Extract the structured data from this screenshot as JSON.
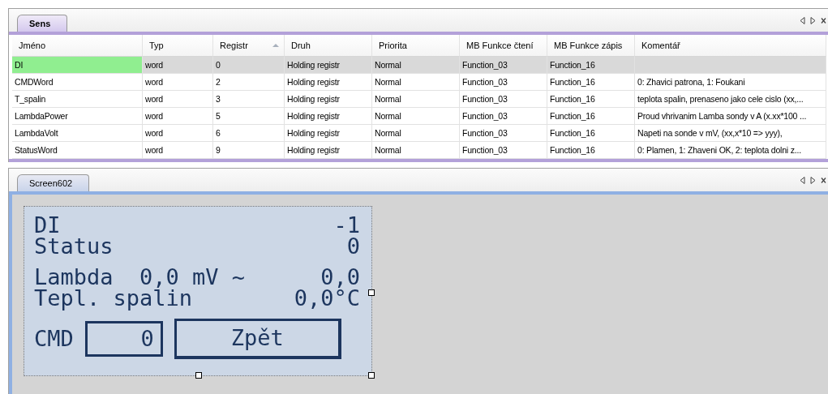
{
  "top_panel": {
    "tabs": [
      {
        "label": "Sens",
        "selected": true
      }
    ],
    "table": {
      "columns": [
        {
          "label": "Jméno",
          "sorted": false
        },
        {
          "label": "Typ",
          "sorted": false
        },
        {
          "label": "Registr",
          "sorted": true
        },
        {
          "label": "Druh",
          "sorted": false
        },
        {
          "label": "Priorita",
          "sorted": false
        },
        {
          "label": "MB Funkce čtení",
          "sorted": false
        },
        {
          "label": "MB Funkce zápis",
          "sorted": false
        },
        {
          "label": "Komentář",
          "sorted": false
        }
      ],
      "rows": [
        {
          "selected": true,
          "cells": [
            "DI",
            "word",
            "0",
            "Holding registr",
            "Normal",
            "Function_03",
            "Function_16",
            ""
          ]
        },
        {
          "selected": false,
          "cells": [
            "CMDWord",
            "word",
            "2",
            "Holding registr",
            "Normal",
            "Function_03",
            "Function_16",
            "0: Zhavici patrona, 1: Foukani"
          ]
        },
        {
          "selected": false,
          "cells": [
            "T_spalin",
            "word",
            "3",
            "Holding registr",
            "Normal",
            "Function_03",
            "Function_16",
            "teplota spalin, prenaseno jako cele cislo (xx,..."
          ]
        },
        {
          "selected": false,
          "cells": [
            "LambdaPower",
            "word",
            "5",
            "Holding registr",
            "Normal",
            "Function_03",
            "Function_16",
            "Proud vhrivanim Lamba sondy v A (x.xx*100 ..."
          ]
        },
        {
          "selected": false,
          "cells": [
            "LambdaVolt",
            "word",
            "6",
            "Holding registr",
            "Normal",
            "Function_03",
            "Function_16",
            "Napeti na sonde v mV, (xx,x*10 => yyy),"
          ]
        },
        {
          "selected": false,
          "cells": [
            "StatusWord",
            "word",
            "9",
            "Holding registr",
            "Normal",
            "Function_03",
            "Function_16",
            "0: Plamen, 1: Zhaveni OK, 2: teplota dolni z..."
          ]
        }
      ]
    }
  },
  "bottom_panel": {
    "tabs": [
      {
        "label": "Screen602",
        "selected": false
      }
    ],
    "lcd": {
      "groups": [
        [
          {
            "label": "DI",
            "value": "-1"
          },
          {
            "label": "Status",
            "value": "0"
          }
        ],
        [
          {
            "label": "Lambda  0,0 mV ~",
            "value": "0,0"
          },
          {
            "label": "Tepl. spalin",
            "value": "0,0°C"
          }
        ]
      ],
      "cmd_label": "CMD",
      "cmd_value": "0",
      "button": "Zpět"
    }
  }
}
